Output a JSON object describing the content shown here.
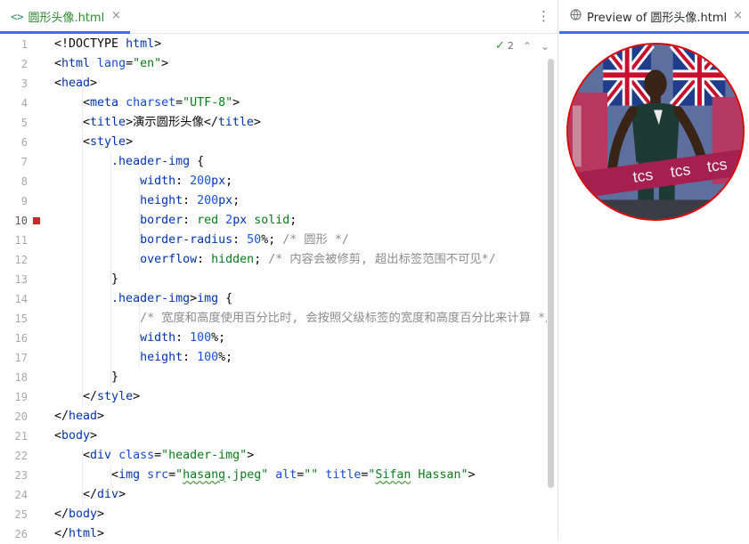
{
  "editor": {
    "tab_icon": "<>",
    "tab_title": "圆形头像.html",
    "close_glyph": "×",
    "menu_glyph": "⋮",
    "current_line": 10,
    "breakpoint_line": 10,
    "inspection": {
      "check_icon": "check-icon",
      "check": "✓",
      "count": "2",
      "up": "⌃",
      "down": "⌄"
    }
  },
  "preview": {
    "tab_title": "Preview of 圆形头像.html",
    "close_glyph": "×",
    "globe_glyph": "🌐",
    "image": {
      "description_icon": "runner-photo",
      "banner_text": [
        "tcs",
        "tcs",
        "tcs"
      ],
      "border_color": "#e00000"
    }
  },
  "code_lines": [
    [
      [
        "t-txt",
        "<!DOCTYPE "
      ],
      [
        "t-tag",
        "html"
      ],
      [
        "t-txt",
        ">"
      ]
    ],
    [
      [
        "t-txt",
        "<"
      ],
      [
        "t-tag",
        "html "
      ],
      [
        "t-attr",
        "lang"
      ],
      [
        "t-txt",
        "="
      ],
      [
        "t-str",
        "\"en\""
      ],
      [
        "t-txt",
        ">"
      ]
    ],
    [
      [
        "t-txt",
        "<"
      ],
      [
        "t-tag",
        "head"
      ],
      [
        "t-txt",
        ">"
      ]
    ],
    [
      [
        "t-txt",
        "    <"
      ],
      [
        "t-tag",
        "meta "
      ],
      [
        "t-attr",
        "charset"
      ],
      [
        "t-txt",
        "="
      ],
      [
        "t-str",
        "\"UTF-8\""
      ],
      [
        "t-txt",
        ">"
      ]
    ],
    [
      [
        "t-txt",
        "    <"
      ],
      [
        "t-tag",
        "title"
      ],
      [
        "t-txt",
        ">演示圆形头像</"
      ],
      [
        "t-tag",
        "title"
      ],
      [
        "t-txt",
        ">"
      ]
    ],
    [
      [
        "t-txt",
        "    <"
      ],
      [
        "t-tag",
        "style"
      ],
      [
        "t-txt",
        ">"
      ]
    ],
    [
      [
        "t-txt",
        "        "
      ],
      [
        "t-sel",
        ".header-img"
      ],
      [
        "t-pun",
        " {"
      ]
    ],
    [
      [
        "t-txt",
        "            "
      ],
      [
        "t-prop",
        "width"
      ],
      [
        "t-pun",
        ": "
      ],
      [
        "t-num",
        "200"
      ],
      [
        "t-prop",
        "px"
      ],
      [
        "t-pun",
        ";"
      ]
    ],
    [
      [
        "t-txt",
        "            "
      ],
      [
        "t-prop",
        "height"
      ],
      [
        "t-pun",
        ": "
      ],
      [
        "t-num",
        "200"
      ],
      [
        "t-prop",
        "px"
      ],
      [
        "t-pun",
        ";"
      ]
    ],
    [
      [
        "t-txt",
        "            "
      ],
      [
        "t-prop",
        "border"
      ],
      [
        "t-pun",
        ": "
      ],
      [
        "t-val",
        "red "
      ],
      [
        "t-num",
        "2"
      ],
      [
        "t-prop",
        "px "
      ],
      [
        "t-val",
        "solid"
      ],
      [
        "t-pun",
        ";"
      ]
    ],
    [
      [
        "t-txt",
        "            "
      ],
      [
        "t-prop",
        "border-radius"
      ],
      [
        "t-pun",
        ": "
      ],
      [
        "t-num",
        "50"
      ],
      [
        "t-pun",
        "%; "
      ],
      [
        "t-com",
        "/* 圆形 */"
      ]
    ],
    [
      [
        "t-txt",
        "            "
      ],
      [
        "t-prop",
        "overflow"
      ],
      [
        "t-pun",
        ": "
      ],
      [
        "t-val",
        "hidden"
      ],
      [
        "t-pun",
        "; "
      ],
      [
        "t-com",
        "/* 内容会被修剪, 超出标签范围不可见*/"
      ]
    ],
    [
      [
        "t-txt",
        "        "
      ],
      [
        "t-pun",
        "}"
      ]
    ],
    [
      [
        "t-txt",
        "        "
      ],
      [
        "t-sel",
        ".header-img"
      ],
      [
        "t-pun",
        ">"
      ],
      [
        "t-sel",
        "img"
      ],
      [
        "t-pun",
        " {"
      ]
    ],
    [
      [
        "t-txt",
        "            "
      ],
      [
        "t-com",
        "/* 宽度和高度使用百分比时, 会按照父级标签的宽度和高度百分比来计算 */"
      ]
    ],
    [
      [
        "t-txt",
        "            "
      ],
      [
        "t-prop",
        "width"
      ],
      [
        "t-pun",
        ": "
      ],
      [
        "t-num",
        "100"
      ],
      [
        "t-pun",
        "%;"
      ]
    ],
    [
      [
        "t-txt",
        "            "
      ],
      [
        "t-prop",
        "height"
      ],
      [
        "t-pun",
        ": "
      ],
      [
        "t-num",
        "100"
      ],
      [
        "t-pun",
        "%;"
      ]
    ],
    [
      [
        "t-txt",
        "        "
      ],
      [
        "t-pun",
        "}"
      ]
    ],
    [
      [
        "t-txt",
        "    </"
      ],
      [
        "t-tag",
        "style"
      ],
      [
        "t-txt",
        ">"
      ]
    ],
    [
      [
        "t-txt",
        "</"
      ],
      [
        "t-tag",
        "head"
      ],
      [
        "t-txt",
        ">"
      ]
    ],
    [
      [
        "t-txt",
        "<"
      ],
      [
        "t-tag",
        "body"
      ],
      [
        "t-txt",
        ">"
      ]
    ],
    [
      [
        "t-txt",
        "    <"
      ],
      [
        "t-tag",
        "div "
      ],
      [
        "t-attr",
        "class"
      ],
      [
        "t-txt",
        "="
      ],
      [
        "t-str",
        "\"header-img\""
      ],
      [
        "t-txt",
        ">"
      ]
    ],
    [
      [
        "t-txt",
        "        <"
      ],
      [
        "t-tag",
        "img "
      ],
      [
        "t-attr",
        "src"
      ],
      [
        "t-txt",
        "="
      ],
      [
        "t-str",
        "\""
      ],
      [
        "t-str squig",
        "hasang"
      ],
      [
        "t-str",
        ".jpeg\" "
      ],
      [
        "t-attr",
        "alt"
      ],
      [
        "t-txt",
        "="
      ],
      [
        "t-str",
        "\"\" "
      ],
      [
        "t-attr",
        "title"
      ],
      [
        "t-txt",
        "="
      ],
      [
        "t-str",
        "\""
      ],
      [
        "t-str squig",
        "Sifan"
      ],
      [
        "t-str",
        " Hassan\""
      ],
      [
        "t-txt",
        ">"
      ]
    ],
    [
      [
        "t-txt",
        "    </"
      ],
      [
        "t-tag",
        "div"
      ],
      [
        "t-txt",
        ">"
      ]
    ],
    [
      [
        "t-txt",
        "</"
      ],
      [
        "t-tag",
        "body"
      ],
      [
        "t-txt",
        ">"
      ]
    ],
    [
      [
        "t-txt",
        "</"
      ],
      [
        "t-tag",
        "html"
      ],
      [
        "t-txt",
        ">"
      ]
    ]
  ]
}
